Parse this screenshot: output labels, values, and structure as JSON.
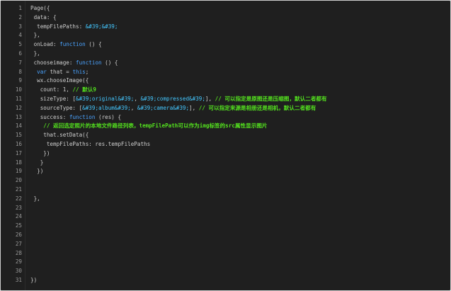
{
  "editor": {
    "lines": [
      {
        "n": "1",
        "t": "Page({"
      },
      {
        "n": "2",
        "t": " data: {"
      },
      {
        "n": "3",
        "t": "  tempFilePaths: &#39;&#39;"
      },
      {
        "n": "4",
        "t": " },"
      },
      {
        "n": "5",
        "t": " onLoad: function () {"
      },
      {
        "n": "6",
        "t": " },"
      },
      {
        "n": "7",
        "t": " chooseimage: function () {"
      },
      {
        "n": "8",
        "t": "  var that = this;"
      },
      {
        "n": "9",
        "t": "  wx.chooseImage({"
      },
      {
        "n": "10",
        "t": "   count: 1, // 默认9"
      },
      {
        "n": "11",
        "t": "   sizeType: [&#39;original&#39;, &#39;compressed&#39;], // 可以指定是原图还是压缩图，默认二者都有"
      },
      {
        "n": "12",
        "t": "   sourceType: [&#39;album&#39;, &#39;camera&#39;], // 可以指定来源是相册还是相机，默认二者都有"
      },
      {
        "n": "13",
        "t": "   success: function (res) {"
      },
      {
        "n": "14",
        "t": "    // 返回选定照片的本地文件路径列表，tempFilePath可以作为img标签的src属性显示图片"
      },
      {
        "n": "15",
        "t": "    that.setData({"
      },
      {
        "n": "16",
        "t": "     tempFilePaths: res.tempFilePaths"
      },
      {
        "n": "17",
        "t": "    })"
      },
      {
        "n": "18",
        "t": "   }"
      },
      {
        "n": "19",
        "t": "  })"
      },
      {
        "n": "20",
        "t": ""
      },
      {
        "n": "21",
        "t": ""
      },
      {
        "n": "22",
        "t": " },"
      },
      {
        "n": "23",
        "t": ""
      },
      {
        "n": "24",
        "t": ""
      },
      {
        "n": "25",
        "t": ""
      },
      {
        "n": "26",
        "t": ""
      },
      {
        "n": "27",
        "t": ""
      },
      {
        "n": "28",
        "t": ""
      },
      {
        "n": "29",
        "t": ""
      },
      {
        "n": "30",
        "t": ""
      },
      {
        "n": "31",
        "t": "})"
      }
    ]
  },
  "colors": {
    "background": "#1f1f1f",
    "keyword": "#4aa3ff",
    "string": "#44c7ff",
    "comment": "#53e01e",
    "text": "#cfcfcf",
    "line_number": "#9a9a9a"
  }
}
